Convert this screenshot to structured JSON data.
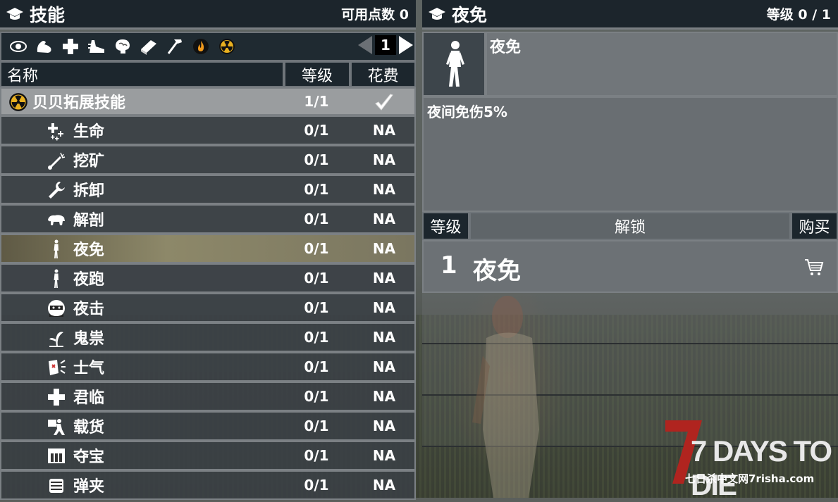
{
  "left_panel": {
    "title": "技能",
    "points_label": "可用点数 0",
    "page_number": "1",
    "category_icons": [
      "eye-icon",
      "muscle-icon",
      "cross-icon",
      "running-shoe-icon",
      "brain-icon",
      "book-icon",
      "hammer-icon",
      "fire-icon",
      "radiation-icon"
    ],
    "columns": {
      "name": "名称",
      "level": "等级",
      "cost": "花费"
    },
    "group": {
      "name": "贝贝拓展技能",
      "level": "1/1",
      "cost_icon": "check-icon"
    },
    "skills": [
      {
        "name": "生命",
        "level": "0/1",
        "cost": "NA",
        "icon": "sparkle-plus-icon"
      },
      {
        "name": "挖矿",
        "level": "0/1",
        "cost": "NA",
        "icon": "mining-icon"
      },
      {
        "name": "拆卸",
        "level": "0/1",
        "cost": "NA",
        "icon": "wrench-icon"
      },
      {
        "name": "解剖",
        "level": "0/1",
        "cost": "NA",
        "icon": "animal-icon"
      },
      {
        "name": "夜免",
        "level": "0/1",
        "cost": "NA",
        "icon": "walking-man-icon",
        "selected": true
      },
      {
        "name": "夜跑",
        "level": "0/1",
        "cost": "NA",
        "icon": "walking-man-icon"
      },
      {
        "name": "夜击",
        "level": "0/1",
        "cost": "NA",
        "icon": "ninja-icon"
      },
      {
        "name": "鬼祟",
        "level": "0/1",
        "cost": "NA",
        "icon": "sneak-icon"
      },
      {
        "name": "士气",
        "level": "0/1",
        "cost": "NA",
        "icon": "morale-icon"
      },
      {
        "name": "君临",
        "level": "0/1",
        "cost": "NA",
        "icon": "cross-icon"
      },
      {
        "name": "载货",
        "level": "0/1",
        "cost": "NA",
        "icon": "carry-icon"
      },
      {
        "name": "夺宝",
        "level": "0/1",
        "cost": "NA",
        "icon": "loot-icon"
      },
      {
        "name": "弹夹",
        "level": "0/1",
        "cost": "NA",
        "icon": "magazine-icon"
      }
    ]
  },
  "right_panel": {
    "title": "夜免",
    "level_label": "等级 0 / 1",
    "skill_name": "夜免",
    "description": "夜间免伤5%",
    "columns": {
      "level": "等级",
      "unlock": "解锁",
      "buy": "购买"
    },
    "unlock_rows": [
      {
        "level": "1",
        "name": "夜免",
        "buy_icon": "cart-icon"
      }
    ]
  },
  "watermark": {
    "logo": "7 DAYS TO DIE",
    "site": "七日杀中文网7risha.com"
  },
  "colors": {
    "header_bg": "#1c252c",
    "row_bg": "#3f474d",
    "selected_row": "#8a8568",
    "border": "#7b8084"
  }
}
